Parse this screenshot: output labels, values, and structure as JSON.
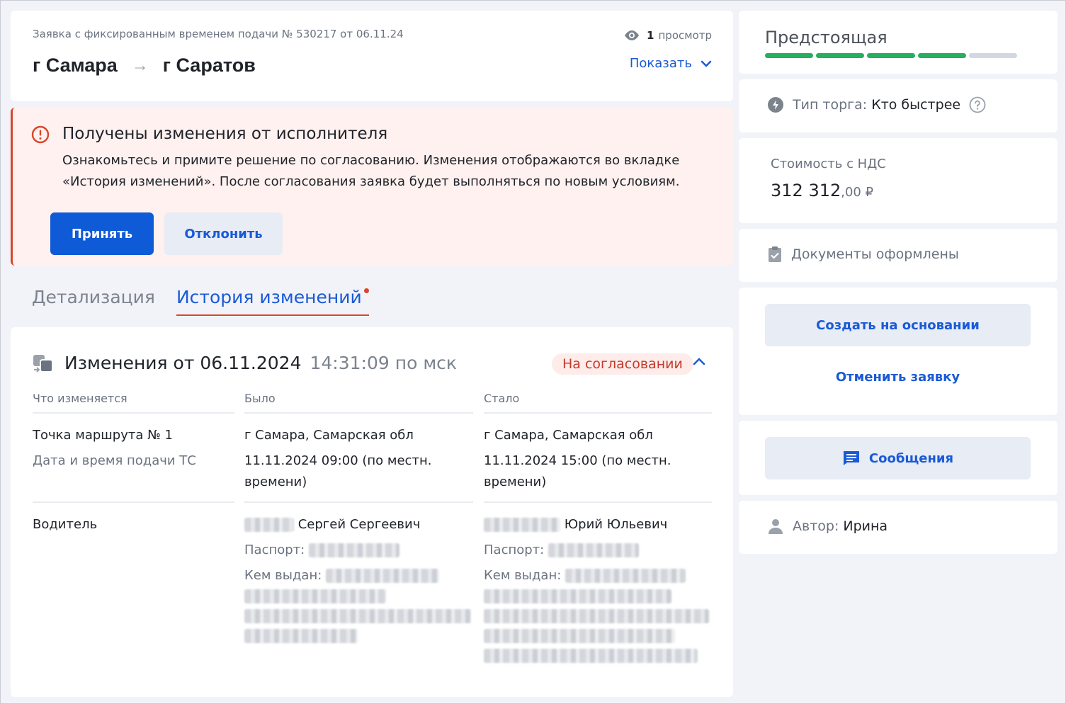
{
  "header": {
    "subtitle": "Заявка с фиксированным временем подачи № 530217 от 06.11.24",
    "from": "г Самара",
    "to": "г Саратов",
    "views_count": "1",
    "views_label": "просмотр",
    "show_label": "Показать"
  },
  "alert": {
    "title": "Получены изменения от исполнителя",
    "text": "Ознакомьтесь и примите решение по согласованию. Изменения отображаются во вкладке «История изменений». После согласования заявка будет выполняться по новым условиям.",
    "accept_label": "Принять",
    "reject_label": "Отклонить"
  },
  "tabs": [
    {
      "label": "Детализация",
      "active": false
    },
    {
      "label": "История изменений",
      "active": true
    }
  ],
  "changes": {
    "title": "Изменения от 06.11.2024",
    "time": "14:31:09 по мск",
    "status": "На согласовании",
    "columns": [
      "Что изменяется",
      "Было",
      "Стало"
    ],
    "rows": [
      {
        "what": "Точка маршрута № 1",
        "what_sub": "Дата и время подачи ТС",
        "was": "г Самара, Самарская обл",
        "was_sub": "11.11.2024 09:00 (по местн. времени)",
        "now": "г Самара, Самарская обл",
        "now_sub": "11.11.2024 15:00 (по местн. времени)"
      },
      {
        "what": "Водитель",
        "was_name": "Сергей Сергеевич",
        "now_name": "Юрий Юльевич",
        "passport_label": "Паспорт:",
        "issued_label": "Кем выдан:"
      }
    ]
  },
  "sidebar": {
    "status_title": "Предстоящая",
    "progress_filled": 4,
    "progress_total": 5,
    "colors": {
      "filled": "#27ae60",
      "empty": "#d3d8e0",
      "accent": "#1a5ad7",
      "alert": "#d9462b"
    },
    "trade_label": "Тип торга:",
    "trade_value": "Кто быстрее",
    "price_label": "Стоимость с НДС",
    "price_rub": "312 312",
    "price_kop": ",00 ₽",
    "docs_label": "Документы оформлены",
    "create_label": "Создать на основании",
    "cancel_label": "Отменить заявку",
    "messages_label": "Сообщения",
    "author_label": "Автор:",
    "author_value": "Ирина"
  },
  "icons": [
    "eye-icon",
    "chevron-down-icon",
    "alert-circle-icon",
    "changes-icon",
    "chevron-up-icon",
    "lightning-icon",
    "help-icon",
    "clipboard-check-icon",
    "message-icon",
    "user-icon"
  ]
}
